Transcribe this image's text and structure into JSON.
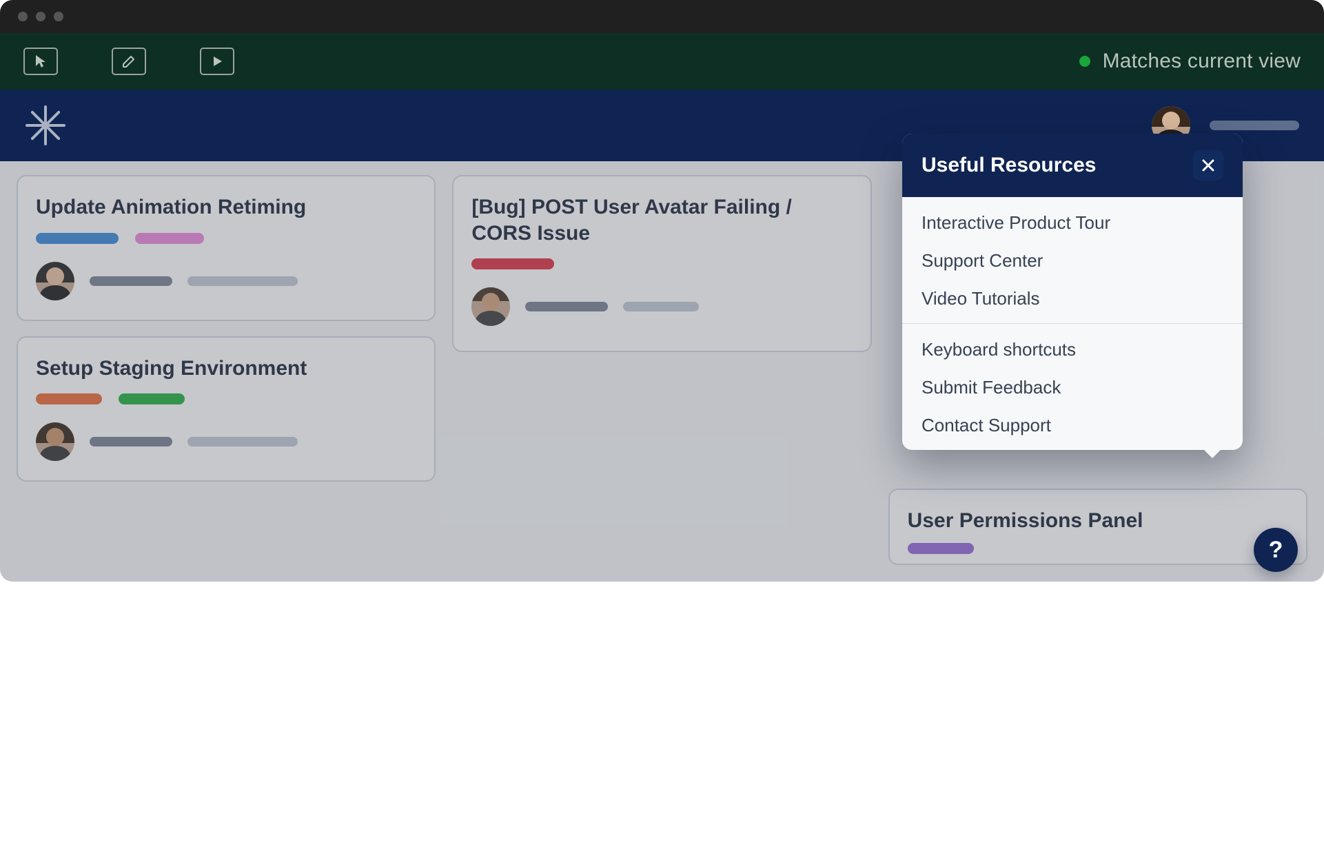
{
  "toolbar": {
    "status_text": "Matches current view"
  },
  "board": {
    "columns": [
      {
        "cards": [
          {
            "title": "Update Animation Retiming"
          },
          {
            "title": "Setup Staging Environment"
          }
        ]
      },
      {
        "cards": [
          {
            "title": "[Bug] POST User Avatar Failing / CORS Issue"
          }
        ]
      },
      {
        "cards": [
          {
            "title": "User Permissions Panel"
          }
        ]
      }
    ]
  },
  "popover": {
    "title": "Useful Resources",
    "section1": [
      "Interactive Product Tour",
      "Support Center",
      "Video Tutorials"
    ],
    "section2": [
      "Keyboard shortcuts",
      "Submit Feedback",
      "Contact Support"
    ]
  },
  "help_fab": {
    "label": "?"
  }
}
